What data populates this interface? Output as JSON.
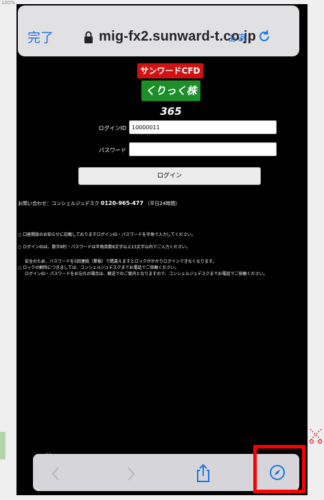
{
  "status_tiny": "100%",
  "browser": {
    "done_label": "完了",
    "url": "mig-fx2.sunward-t.co.jp",
    "text_size_label": "ぁあ"
  },
  "logo": {
    "top": "サンワードCFD",
    "bottom": "くりっく株365"
  },
  "form": {
    "login_id_label": "ログインID",
    "login_id_value": "10000011",
    "password_label": "パスワード",
    "password_value": "",
    "login_button": "ログイン"
  },
  "contact": {
    "prefix": "お問い合わせ：コンシェルジュデスク",
    "phone": "0120-965-477",
    "hours": "（平日24時間）"
  },
  "notices": [
    "○ 口座開設のお知らせに記載しておりますログインID・パスワードを半角で入力してください。",
    "○ ログインIDは、数字8桁・パスワードは半角英数8文字以上13文字以内でご入力ください。"
  ],
  "notice_block": {
    "line1": "安全のため、パスワードを5回連続（累積）で間違えますとロックがかかりログインできなくなります。",
    "line2": "ロックの解除につきましては、コンシェルジュデスクまでお電話でご依頼ください。",
    "line3": "ログインID・パスワードをお忘れの場合は、郵送でのご案内となりますので、コンシェルジュデスクまでお電話でご依頼ください。"
  },
  "bottom_fragment": "い",
  "toolbar": {
    "icons": [
      "back-icon",
      "forward-icon",
      "share-icon",
      "compass-icon"
    ]
  },
  "colors": {
    "accent": "#1a73e8",
    "highlight": "#ff0000",
    "logo_red": "#d01212",
    "logo_green": "#1d8f2a"
  }
}
